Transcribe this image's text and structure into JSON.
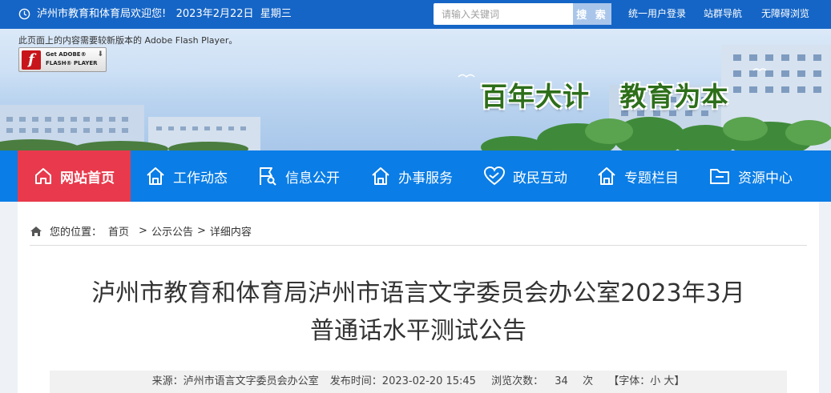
{
  "topbar": {
    "welcome": "泸州市教育和体育局欢迎您!",
    "date": "2023年2月22日",
    "weekday": "星期三",
    "search_placeholder": "请输入关键词",
    "search_label": "搜 索",
    "links": [
      "统一用户登录",
      "站群导航",
      "无障碍浏览"
    ]
  },
  "banner": {
    "flash_notice": "此页面上的内容需要较新版本的 Adobe Flash Player。",
    "flash_badge_line1": "Get ADOBE®",
    "flash_badge_line2": "FLASH® PLAYER",
    "flash_logo": "f",
    "slogan_left": "百年大计",
    "slogan_right": "教育为本"
  },
  "nav": {
    "items": [
      {
        "label": "网站首页",
        "icon": "home-icon",
        "active": true
      },
      {
        "label": "工作动态",
        "icon": "house-icon"
      },
      {
        "label": "信息公开",
        "icon": "flag-search-icon"
      },
      {
        "label": "办事服务",
        "icon": "house-icon"
      },
      {
        "label": "政民互动",
        "icon": "heart-icon"
      },
      {
        "label": "专题栏目",
        "icon": "house-icon"
      },
      {
        "label": "资源中心",
        "icon": "folder-icon"
      }
    ]
  },
  "breadcrumb": {
    "prefix": "您的位置：",
    "items": [
      "首页",
      "公示公告",
      "详细内容"
    ],
    "separator": ">"
  },
  "article": {
    "title_line1": "泸州市教育和体育局泸州市语言文字委员会办公室2023年3月",
    "title_line2": "普通话水平测试公告",
    "source": "来源：泸州市语言文字委员会办公室",
    "published": "发布时间：2023-02-20 15:45",
    "views_label": "浏览次数：",
    "views": "34",
    "views_unit": "次",
    "font_size": "【字体：小 大】"
  },
  "colors": {
    "topbar": "#1565c6",
    "nav": "#0a7de6",
    "nav_active": "#e83a4c",
    "slogan": "#2d6e1a"
  }
}
